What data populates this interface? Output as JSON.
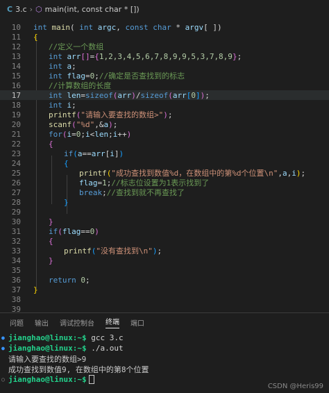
{
  "breadcrumb": {
    "file": "3.c",
    "func": "main(int, const char * [])"
  },
  "code": {
    "line_numbers": [
      "10",
      "11",
      "12",
      "13",
      "14",
      "15",
      "16",
      "17",
      "18",
      "19",
      "20",
      "21",
      "22",
      "23",
      "24",
      "25",
      "26",
      "27",
      "28",
      "29",
      "30",
      "31",
      "32",
      "33",
      "34",
      "35",
      "36",
      "37",
      "38",
      "39"
    ],
    "l10": "int main( int argc, const char * argv[ ])",
    "l11": "{",
    "l12": "//定义一个数组",
    "l13a": "int arr[]={1,2,3,4,5,6,7,8,9,9,5,3,7,8,9};",
    "l14": "int a;",
    "l15a": "int flag=0;",
    "l15b": "//确定是否查找到的标志",
    "l16": "//计算数组的长度",
    "l17": "int len=sizeof(arr)/sizeof(arr[0]);",
    "l18": "int i;",
    "l19": "printf(\"请输入要查找的数组>\");",
    "l20": "scanf(\"%d\",&a);",
    "l21": "for(i=0;i<len;i++)",
    "l22": "{",
    "l23": "if(a==arr[i])",
    "l24": "{",
    "l25": "printf(\"成功查找到数值%d，在数组中的第%d个位置\\n\",a,i);",
    "l26a": "flag=1;",
    "l26b": "//标志位设置为1表示找到了",
    "l27a": "break;",
    "l27b": "//查找到就不再查找了",
    "l28": "}",
    "l30": "}",
    "l31": "if(flag==0)",
    "l32": "{",
    "l33": "printf(\"没有查找到\\n\");",
    "l34": "}",
    "l36": "return 0;",
    "l37": "}"
  },
  "panel": {
    "tabs": [
      "问题",
      "输出",
      "调试控制台",
      "终端",
      "端口"
    ],
    "active_tab": "终端"
  },
  "terminal": {
    "l1_prompt": "jianghao@linux:~$",
    "l1_cmd": " gcc 3.c",
    "l2_prompt": "jianghao@linux:~$",
    "l2_cmd": " ./a.out",
    "l3": "请输入要查找的数组>9",
    "l4": "成功查找到数值9, 在数组中的第8个位置",
    "l5_prompt": "jianghao@linux:~$"
  },
  "watermark": "CSDN @Heris99",
  "colors": {
    "keyword": "#569cd6",
    "function": "#dcdcaa",
    "string": "#ce9178",
    "comment": "#6a9955",
    "prompt": "#23d18b"
  }
}
